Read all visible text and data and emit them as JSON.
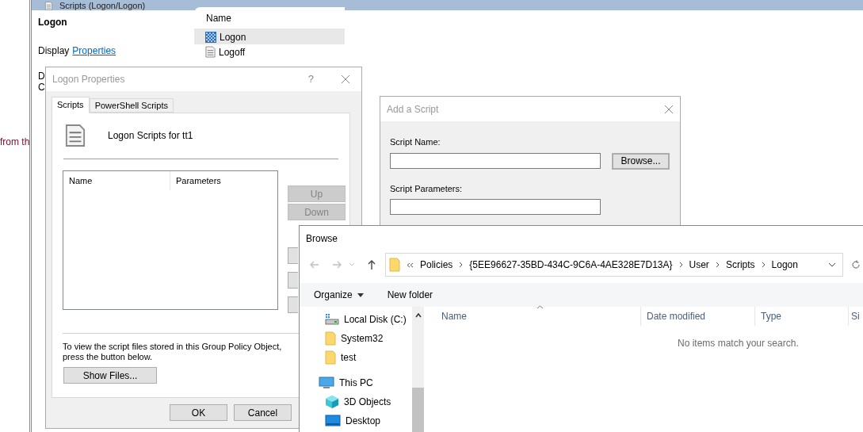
{
  "background_text": "from th",
  "mmc": {
    "title": "Scripts (Logon/Logon)",
    "heading": "Logon",
    "display_label": "Display",
    "properties_link": "Properties",
    "partial_lines": [
      "D",
      "C"
    ],
    "list": {
      "column": "Name",
      "items": [
        {
          "label": "Logon",
          "selected": true
        },
        {
          "label": "Logoff",
          "selected": false
        }
      ]
    }
  },
  "logon_properties": {
    "title": "Logon Properties",
    "help": "?",
    "tabs": [
      {
        "label": "Scripts",
        "selected": true
      },
      {
        "label": "PowerShell Scripts",
        "selected": false
      }
    ],
    "heading": "Logon Scripts for tt1",
    "columns": [
      "Name",
      "Parameters"
    ],
    "side_buttons": [
      {
        "label": "Up",
        "disabled": true
      },
      {
        "label": "Down",
        "disabled": true
      }
    ],
    "note": "To view the script files stored in this Group Policy Object, press the button below.",
    "show_files": "Show Files...",
    "footer_buttons": [
      "OK",
      "Cancel"
    ]
  },
  "add_script": {
    "title": "Add a Script",
    "fields": [
      {
        "label": "Script Name:"
      },
      {
        "label": "Script Parameters:"
      }
    ],
    "browse_button": "Browse..."
  },
  "browse": {
    "title": "Browse",
    "path": [
      "Policies",
      "{5EE96627-35BD-434C-9C6A-4AE328E7D13A}",
      "User",
      "Scripts",
      "Logon"
    ],
    "toolbar": [
      {
        "label": "Organize",
        "dropdown": true
      },
      {
        "label": "New folder",
        "dropdown": false
      }
    ],
    "quick_items": [
      {
        "label": "Local Disk (C:)",
        "kind": "drive"
      },
      {
        "label": "System32",
        "kind": "folder"
      },
      {
        "label": "test",
        "kind": "folder"
      }
    ],
    "tree": [
      {
        "label": "This PC",
        "kind": "pc",
        "children": [
          {
            "label": "3D Objects",
            "kind": "cube"
          },
          {
            "label": "Desktop",
            "kind": "desktop"
          }
        ]
      }
    ],
    "columns": [
      "Name",
      "Date modified",
      "Type",
      "Si"
    ],
    "empty_message": "No items match your search."
  }
}
